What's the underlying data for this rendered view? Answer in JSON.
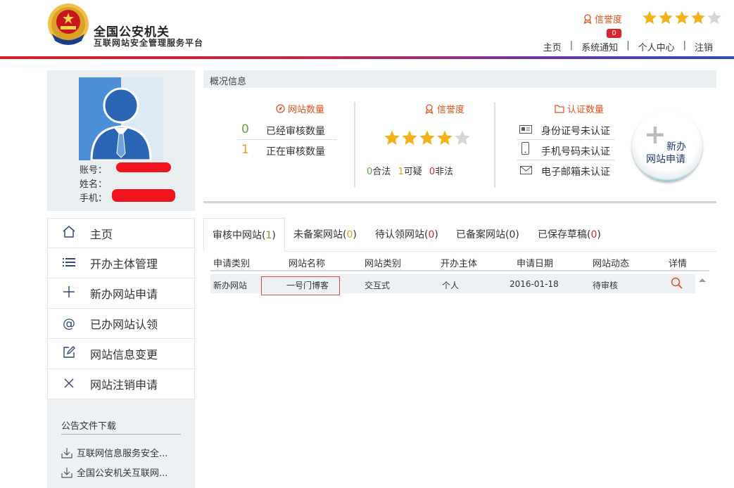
{
  "header": {
    "title_line1": "全国公安机关",
    "title_line2": "互联网站安全管理服务平台",
    "reputation_label": "信誉度",
    "rating": 4,
    "rating_max": 5,
    "notification_count": "0",
    "nav": [
      "主页",
      "系统通知",
      "个人中心",
      "注销"
    ],
    "accent_color": "#e0511b"
  },
  "profile": {
    "account_label": "账号：",
    "name_label": "姓名：",
    "phone_label": "手机："
  },
  "sidebar": {
    "items": [
      {
        "label": "主页",
        "icon": "home-icon"
      },
      {
        "label": "开办主体管理",
        "icon": "list-icon"
      },
      {
        "label": "新办网站申请",
        "icon": "plus-icon"
      },
      {
        "label": "已办网站认领",
        "icon": "at-icon"
      },
      {
        "label": "网站信息变更",
        "icon": "edit-icon"
      },
      {
        "label": "网站注销申请",
        "icon": "close-icon"
      }
    ],
    "notice_title": "公告文件下载",
    "documents": [
      "互联网信息服务安全...",
      "全国公安机关互联网..."
    ]
  },
  "overview": {
    "header": "概况信息",
    "sites": {
      "title": "网站数量",
      "rows": [
        {
          "count": "0",
          "label": "已经审核数量"
        },
        {
          "count": "1",
          "label": "正在审核数量"
        }
      ]
    },
    "reputation": {
      "title": "信誉度",
      "rating": 4,
      "legal_count": "0",
      "legal_label": "合法",
      "suspicious_count": "1",
      "suspicious_label": "可疑",
      "illegal_count": "0",
      "illegal_label": "非法"
    },
    "auth": {
      "title": "认证数量",
      "rows": [
        "身份证号未认证",
        "手机号码未认证",
        "电子邮箱未认证"
      ]
    },
    "new_button_line1": "新办",
    "new_button_line2": "网站申请"
  },
  "tabs": [
    {
      "label": "审核中网站",
      "count": "1",
      "active": true
    },
    {
      "label": "未备案网站",
      "count": "0"
    },
    {
      "label": "待认领网站",
      "count": "0"
    },
    {
      "label": "已备案网站",
      "count": "0"
    },
    {
      "label": "已保存草稿",
      "count": "0"
    }
  ],
  "table": {
    "columns": [
      "申请类别",
      "网站名称",
      "网站类别",
      "开办主体",
      "申请日期",
      "网站动态",
      "详情"
    ],
    "rows": [
      [
        "新办网站",
        "一号门博客",
        "交互式",
        "个人",
        "2016-01-18",
        "待审核"
      ]
    ]
  }
}
